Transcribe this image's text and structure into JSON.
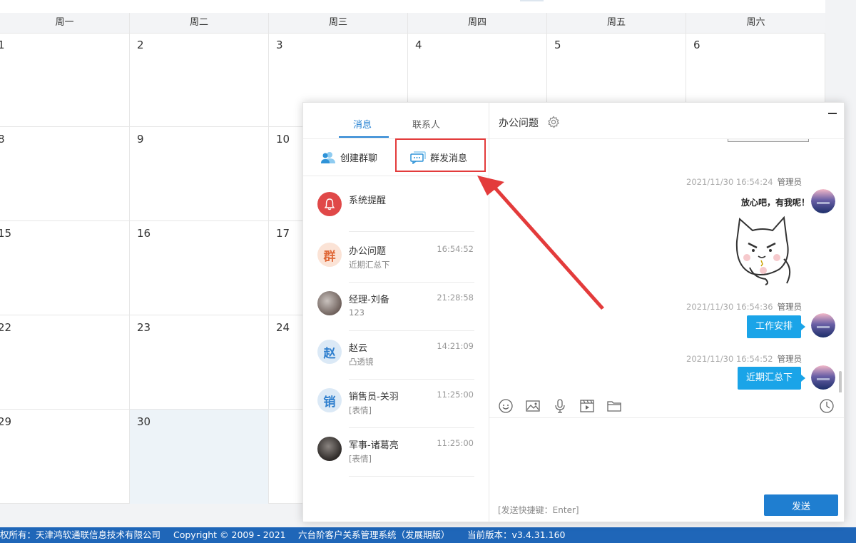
{
  "calendar": {
    "weekdays": [
      "周一",
      "周二",
      "周三",
      "周四",
      "周五",
      "周六"
    ],
    "rows": [
      [
        "1",
        "2",
        "3",
        "4",
        "5",
        "6"
      ],
      [
        "8",
        "9",
        "10",
        "",
        "",
        ""
      ],
      [
        "15",
        "16",
        "17",
        "",
        "",
        ""
      ],
      [
        "22",
        "23",
        "24",
        "",
        "",
        ""
      ],
      [
        "29",
        "30",
        "",
        "",
        "",
        ""
      ]
    ]
  },
  "footer": {
    "copyright_owner": "权所有：天津鸿软通联信息技术有限公司",
    "copyright": "Copyright © 2009 - 2021",
    "system": "六台阶客户关系管理系统（发展期版）",
    "version": "当前版本：v3.4.31.160"
  },
  "chat": {
    "tabs": {
      "messages": "消息",
      "contacts": "联系人"
    },
    "actions": {
      "create_group": "创建群聊",
      "broadcast": "群发消息"
    },
    "conversations": [
      {
        "name": "系统提醒",
        "preview": "",
        "time": "",
        "avatar_text": "",
        "avatar_color": "#e04848"
      },
      {
        "name": "办公问题",
        "preview": "近期汇总下",
        "time": "16:54:52",
        "avatar_text": "群",
        "avatar_color": "#fbe3d6"
      },
      {
        "name": "经理-刘备",
        "preview": "123",
        "time": "21:28:58",
        "avatar_text": "",
        "avatar_color": "#7a6a66"
      },
      {
        "name": "赵云",
        "preview": "凸透镜",
        "time": "14:21:09",
        "avatar_text": "赵",
        "avatar_color": "#dbe9f6"
      },
      {
        "name": "销售员-关羽",
        "preview": "[表情]",
        "time": "11:25:00",
        "avatar_text": "销",
        "avatar_color": "#dbe9f6"
      },
      {
        "name": "军事-诸葛亮",
        "preview": "[表情]",
        "time": "11:25:00",
        "avatar_text": "",
        "avatar_color": "#3a3a3a"
      }
    ],
    "header": {
      "title": "办公问题"
    },
    "messages": [
      {
        "timestamp": "2021/11/30 16:54:24",
        "sender": "管理员",
        "type": "sticker",
        "sticker_text": "放心吧，有我呢！"
      },
      {
        "timestamp": "2021/11/30 16:54:36",
        "sender": "管理员",
        "type": "text",
        "text": "工作安排"
      },
      {
        "timestamp": "2021/11/30 16:54:52",
        "sender": "管理员",
        "type": "text",
        "text": "近期汇总下"
      }
    ],
    "toolbar_icons": [
      "emoji-icon",
      "image-icon",
      "microphone-icon",
      "video-icon",
      "folder-icon",
      "history-clock-icon"
    ],
    "input": {
      "hint": "[发送快捷键：Enter]",
      "send_label": "发送"
    },
    "colors": {
      "accent": "#1f7ed0",
      "bubble": "#1aa4e8",
      "highlight": "#e33b3b"
    }
  }
}
